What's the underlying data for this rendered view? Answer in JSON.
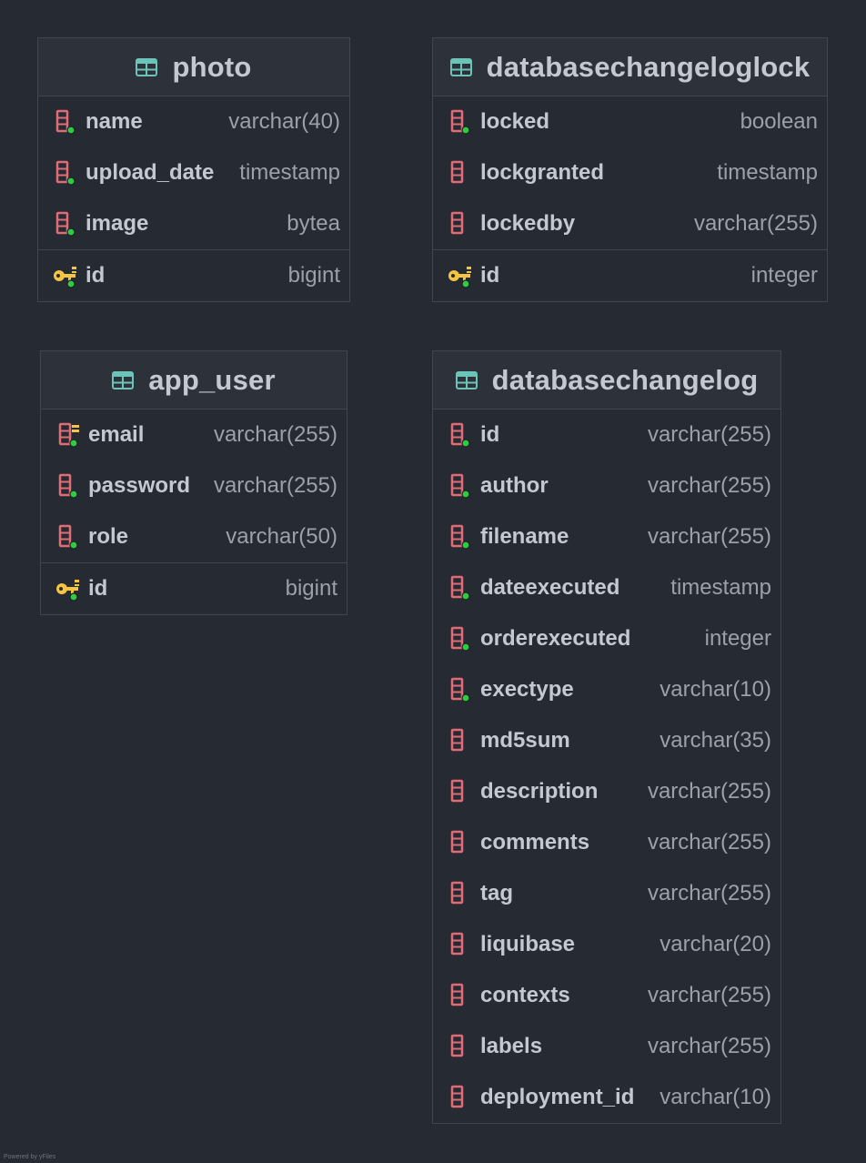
{
  "colors": {
    "background": "#262a33",
    "table_header": "#2d313a",
    "border": "#41454e",
    "table_icon": "#6cc4b8",
    "column_icon": "#e06c75",
    "key_icon": "#f4c542",
    "not_null_dot": "#2ecc40"
  },
  "tables": {
    "photo": {
      "title": "photo",
      "columns": [
        {
          "name": "name",
          "type": "varchar(40)"
        },
        {
          "name": "upload_date",
          "type": "timestamp"
        },
        {
          "name": "image",
          "type": "bytea"
        }
      ],
      "pk": {
        "name": "id",
        "type": "bigint"
      }
    },
    "databasechangeloglock": {
      "title": "databasechangeloglock",
      "columns": [
        {
          "name": "locked",
          "type": "boolean"
        },
        {
          "name": "lockgranted",
          "type": "timestamp"
        },
        {
          "name": "lockedby",
          "type": "varchar(255)"
        }
      ],
      "pk": {
        "name": "id",
        "type": "integer"
      }
    },
    "app_user": {
      "title": "app_user",
      "columns": [
        {
          "name": "email",
          "type": "varchar(255)"
        },
        {
          "name": "password",
          "type": "varchar(255)"
        },
        {
          "name": "role",
          "type": "varchar(50)"
        }
      ],
      "pk": {
        "name": "id",
        "type": "bigint"
      }
    },
    "databasechangelog": {
      "title": "databasechangelog",
      "columns": [
        {
          "name": "id",
          "type": "varchar(255)"
        },
        {
          "name": "author",
          "type": "varchar(255)"
        },
        {
          "name": "filename",
          "type": "varchar(255)"
        },
        {
          "name": "dateexecuted",
          "type": "timestamp"
        },
        {
          "name": "orderexecuted",
          "type": "integer"
        },
        {
          "name": "exectype",
          "type": "varchar(10)"
        },
        {
          "name": "md5sum",
          "type": "varchar(35)"
        },
        {
          "name": "description",
          "type": "varchar(255)"
        },
        {
          "name": "comments",
          "type": "varchar(255)"
        },
        {
          "name": "tag",
          "type": "varchar(255)"
        },
        {
          "name": "liquibase",
          "type": "varchar(20)"
        },
        {
          "name": "contexts",
          "type": "varchar(255)"
        },
        {
          "name": "labels",
          "type": "varchar(255)"
        },
        {
          "name": "deployment_id",
          "type": "varchar(10)"
        }
      ]
    }
  },
  "footer": {
    "credit": "Powered by yFiles"
  }
}
